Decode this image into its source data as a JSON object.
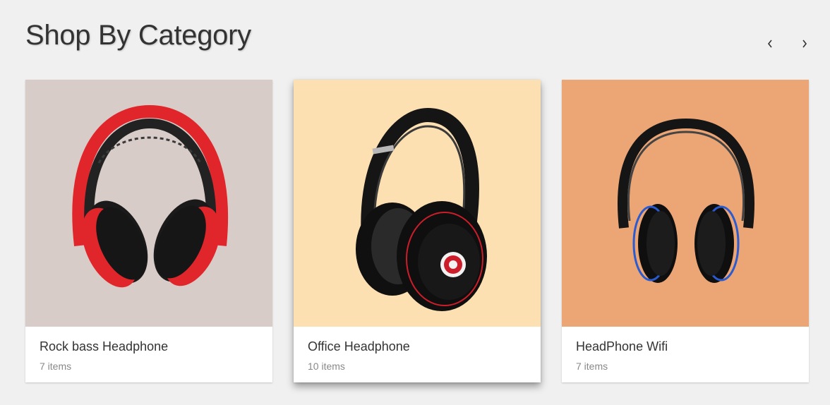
{
  "header": {
    "title": "Shop By Category"
  },
  "nav": {
    "prev_icon": "chevron-left-icon",
    "next_icon": "chevron-right-icon"
  },
  "categories": [
    {
      "title": "Rock bass Headphone",
      "count": "7 items",
      "bg": "#d8ccc8",
      "accent": "#e0262b"
    },
    {
      "title": "Office Headphone",
      "count": "10 items",
      "bg": "#fde0b2",
      "accent": "#cc1e2a"
    },
    {
      "title": "HeadPhone Wifi",
      "count": "7 items",
      "bg": "#eca574",
      "accent": "#2a5bd0"
    }
  ]
}
